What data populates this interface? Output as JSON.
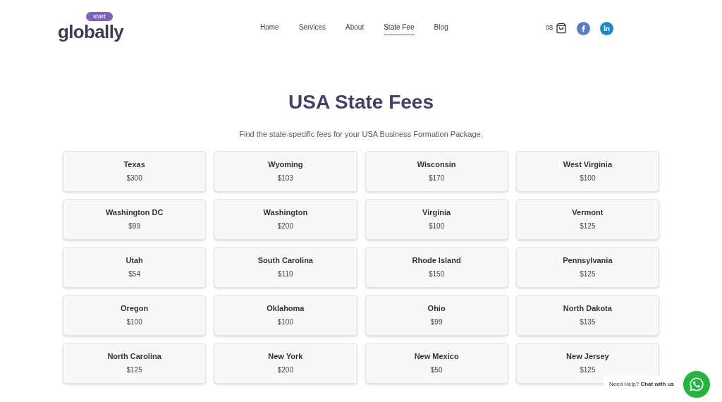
{
  "logo": {
    "badge": "start",
    "wordmark": "globally"
  },
  "nav": [
    {
      "label": "Home",
      "selected": false
    },
    {
      "label": "Services",
      "selected": false
    },
    {
      "label": "About",
      "selected": false
    },
    {
      "label": "State Fee",
      "selected": true
    },
    {
      "label": "Blog",
      "selected": false
    }
  ],
  "cart": {
    "amount": "0$"
  },
  "heading": "USA State Fees",
  "subtitle": "Find the state-specific fees for your USA Business Formation Package.",
  "states": [
    {
      "name": "Texas",
      "fee": "$300"
    },
    {
      "name": "Wyoming",
      "fee": "$103"
    },
    {
      "name": "Wisconsin",
      "fee": "$170"
    },
    {
      "name": "West Virginia",
      "fee": "$100"
    },
    {
      "name": "Washington DC",
      "fee": "$99"
    },
    {
      "name": "Washington",
      "fee": "$200"
    },
    {
      "name": "Virginia",
      "fee": "$100"
    },
    {
      "name": "Vermont",
      "fee": "$125"
    },
    {
      "name": "Utah",
      "fee": "$54"
    },
    {
      "name": "South Carolina",
      "fee": "$110"
    },
    {
      "name": "Rhode Island",
      "fee": "$150"
    },
    {
      "name": "Pennsylvania",
      "fee": "$125"
    },
    {
      "name": "Oregon",
      "fee": "$100"
    },
    {
      "name": "Oklahoma",
      "fee": "$100"
    },
    {
      "name": "Ohio",
      "fee": "$99"
    },
    {
      "name": "North Dakota",
      "fee": "$135"
    },
    {
      "name": "North Carolina",
      "fee": "$125"
    },
    {
      "name": "New York",
      "fee": "$200"
    },
    {
      "name": "New Mexico",
      "fee": "$50"
    },
    {
      "name": "New Jersey",
      "fee": "$125"
    }
  ],
  "chat": {
    "prompt": "Need Help?",
    "action": "Chat with us"
  }
}
